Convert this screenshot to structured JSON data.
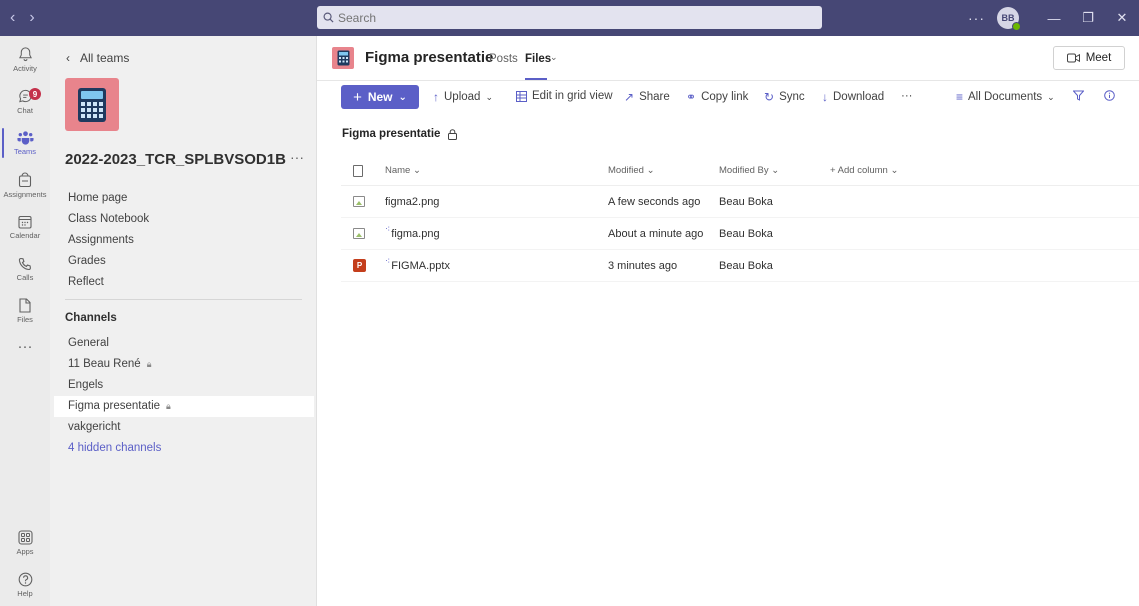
{
  "titlebar": {
    "search_placeholder": "Search",
    "more": "···",
    "avatar_initials": "BB",
    "minimize": "—",
    "maximize": "❐",
    "close": "✕"
  },
  "rail": {
    "chat_badge": "9",
    "items": [
      {
        "label": "Activity",
        "icon": "bell-icon"
      },
      {
        "label": "Chat",
        "icon": "chat-icon"
      },
      {
        "label": "Teams",
        "icon": "teams-icon"
      },
      {
        "label": "Assignments",
        "icon": "assignments-icon"
      },
      {
        "label": "Calendar",
        "icon": "calendar-icon"
      },
      {
        "label": "Calls",
        "icon": "phone-icon"
      },
      {
        "label": "Files",
        "icon": "file-icon"
      },
      {
        "label": "Apps",
        "icon": "apps-icon"
      },
      {
        "label": "Help",
        "icon": "help-icon"
      }
    ],
    "more": "···"
  },
  "pane": {
    "back_label": "All teams",
    "team_name": "2022-2023_TCR_SPLBVSOD1B",
    "team_more": "···",
    "nav": [
      "Home page",
      "Class Notebook",
      "Assignments",
      "Grades",
      "Reflect"
    ],
    "channels_heading": "Channels",
    "channels": [
      "General",
      "11 Beau René",
      "Engels",
      "Figma presentatie",
      "vakgericht"
    ],
    "hidden_channels": "4 hidden channels"
  },
  "header": {
    "title": "Figma presentatie",
    "tab_posts": "Posts",
    "tab_files": "Files",
    "meet_label": "Meet"
  },
  "toolbar": {
    "new": "New",
    "upload": "Upload",
    "edit_grid": "Edit in grid view",
    "share": "Share",
    "copy_link": "Copy link",
    "sync": "Sync",
    "download": "Download",
    "more": "···",
    "view": "All Documents"
  },
  "breadcrumb": "Figma presentatie",
  "table": {
    "columns": {
      "name": "Name",
      "modified": "Modified",
      "modified_by": "Modified By",
      "add_column": "+ Add column"
    },
    "rows": [
      {
        "name": "figma2.png",
        "modified": "A few seconds ago",
        "modified_by": "Beau Boka",
        "type": "image",
        "new": false
      },
      {
        "name": "figma.png",
        "modified": "About a minute ago",
        "modified_by": "Beau Boka",
        "type": "image",
        "new": true
      },
      {
        "name": "FIGMA.pptx",
        "modified": "3 minutes ago",
        "modified_by": "Beau Boka",
        "type": "pptx",
        "new": true
      }
    ]
  },
  "colors": {
    "accent": "#5b5fc7",
    "titlebar": "#464775",
    "team_tile": "#e8848c",
    "badge": "#c4314b"
  }
}
